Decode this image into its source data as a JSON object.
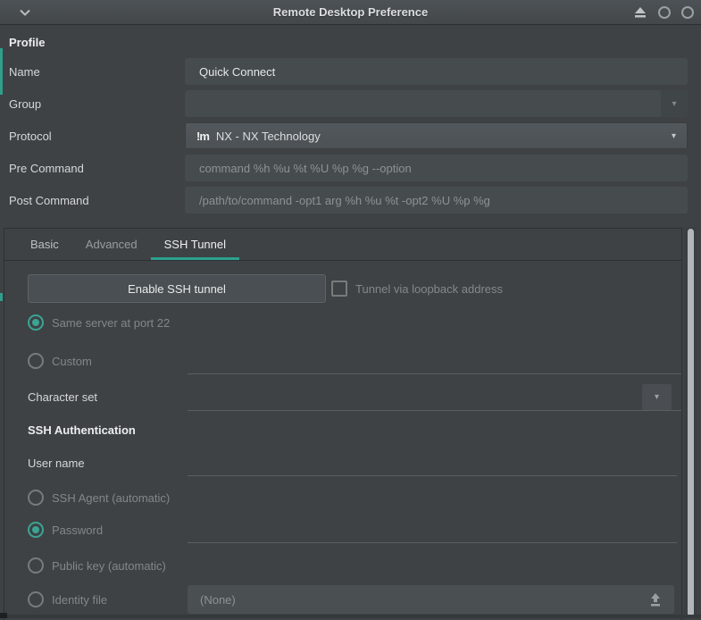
{
  "window": {
    "title": "Remote Desktop Preference"
  },
  "colors": {
    "accent": "#2da28e",
    "background": "#3e4245",
    "entry": "#464b4e"
  },
  "profile": {
    "heading": "Profile",
    "name_label": "Name",
    "name_value": "Quick Connect",
    "group_label": "Group",
    "group_value": "",
    "protocol_label": "Protocol",
    "protocol_icon": "!m",
    "protocol_value": "NX - NX Technology",
    "pre_command_label": "Pre Command",
    "pre_command_placeholder": "command %h %u %t %U %p %g --option",
    "post_command_label": "Post Command",
    "post_command_placeholder": "/path/to/command -opt1 arg %h %u %t -opt2 %U %p %g"
  },
  "tabs": {
    "basic": "Basic",
    "advanced": "Advanced",
    "ssh_tunnel": "SSH Tunnel",
    "active_tab": "SSH Tunnel"
  },
  "tunnel": {
    "enable_button": "Enable SSH tunnel",
    "loopback_label": "Tunnel via loopback address",
    "loopback_checked": false,
    "same_server_label": "Same server at port 22",
    "same_server_selected": true,
    "custom_label": "Custom",
    "custom_selected": false,
    "custom_value": "",
    "charset_label": "Character set",
    "charset_value": ""
  },
  "auth": {
    "heading": "SSH Authentication",
    "username_label": "User name",
    "username_value": "",
    "agent_label": "SSH Agent (automatic)",
    "agent_selected": false,
    "password_label": "Password",
    "password_selected": true,
    "password_value": "",
    "pubkey_label": "Public key (automatic)",
    "pubkey_selected": false,
    "identity_label": "Identity file",
    "identity_selected": false,
    "identity_value": "(None)"
  }
}
